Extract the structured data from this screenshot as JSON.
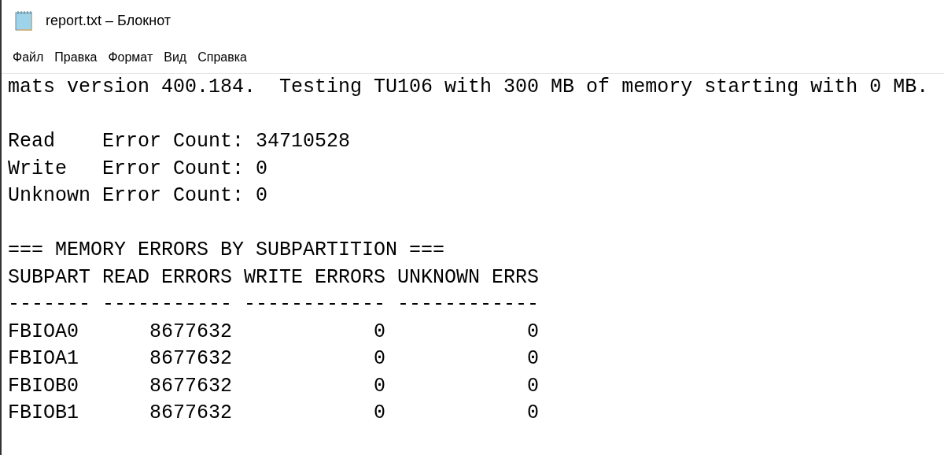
{
  "window": {
    "title": "report.txt – Блокнот"
  },
  "menu": [
    "Файл",
    "Правка",
    "Формат",
    "Вид",
    "Справка"
  ],
  "document": {
    "paragraphs": [
      [
        "mats version 400.184.  Testing TU106 with 300 MB of memory starting with 0 MB."
      ],
      [
        "Read    Error Count: 34710528",
        "Write   Error Count: 0",
        "Unknown Error Count: 0"
      ],
      [
        "=== MEMORY ERRORS BY SUBPARTITION ===",
        "SUBPART READ ERRORS WRITE ERRORS UNKNOWN ERRS",
        "------- ----------- ------------ ------------",
        "FBIOA0      8677632            0            0",
        "FBIOA1      8677632            0            0",
        "FBIOB0      8677632            0            0",
        "FBIOB1      8677632            0            0"
      ]
    ]
  }
}
